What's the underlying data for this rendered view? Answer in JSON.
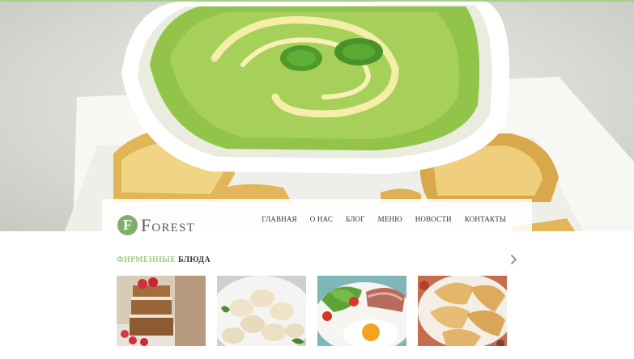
{
  "site": {
    "logo_letter": "F",
    "logo_name": "Forest",
    "accent_color": "#9dcc7f"
  },
  "hero": {
    "image": "green-cream-soup-with-mint-and-toasted-bread"
  },
  "nav": {
    "items": [
      "ГЛАВНАЯ",
      "О НАС",
      "БЛОГ",
      "МЕНЮ",
      "НОВОСТИ",
      "КОНТАКТЫ"
    ]
  },
  "featured": {
    "title_accent": "ФИРМЕННЫЕ",
    "title_rest": "БЛЮДА",
    "next_icon": "chevron-right-icon",
    "dishes": [
      {
        "image": "raspberry-layer-cake"
      },
      {
        "image": "dumplings"
      },
      {
        "image": "fried-egg-salad-plate"
      },
      {
        "image": "crepes"
      }
    ]
  }
}
